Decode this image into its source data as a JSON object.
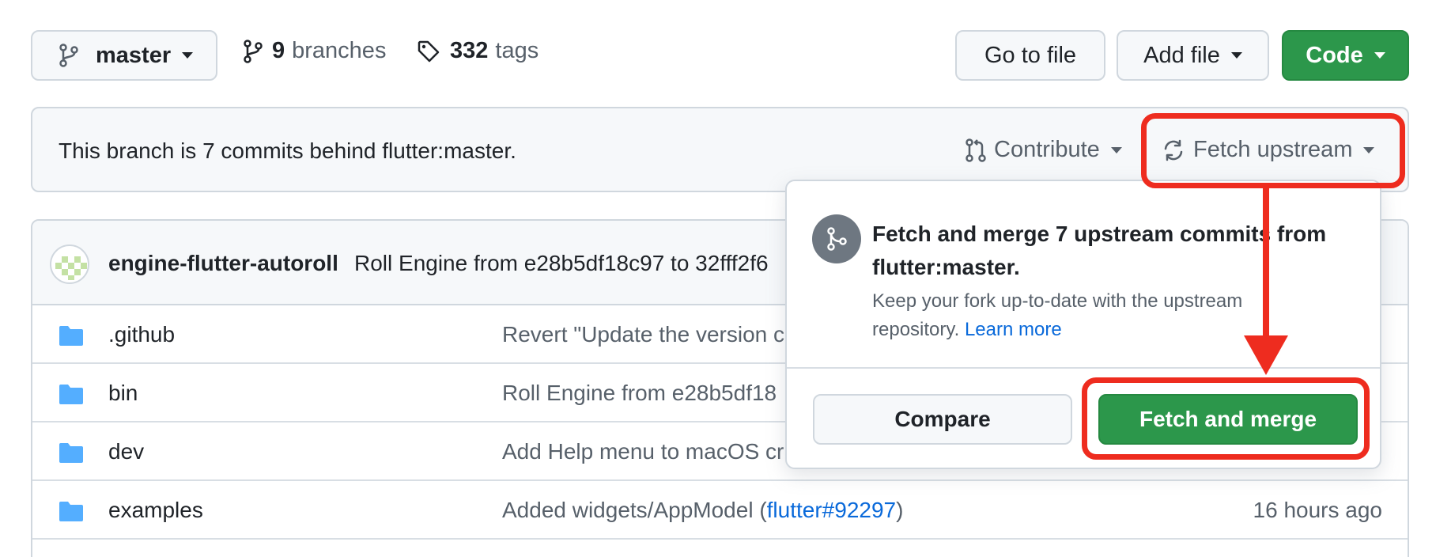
{
  "toolbar": {
    "branch_label": "master",
    "branches_count": "9",
    "branches_label": "branches",
    "tags_count": "332",
    "tags_label": "tags",
    "goto_file_label": "Go to file",
    "add_file_label": "Add file",
    "code_label": "Code",
    "code_color": "#2c974b"
  },
  "status_bar": {
    "behind_text": "This branch is 7 commits behind flutter:master.",
    "contribute_label": "Contribute",
    "fetch_upstream_label": "Fetch upstream"
  },
  "latest_commit": {
    "author": "engine-flutter-autoroll",
    "message": "Roll Engine from e28b5df18c97 to 32fff2f6"
  },
  "files": [
    {
      "name": ".github",
      "message": "Revert \"Update the version c",
      "link": "",
      "message_suffix": "",
      "age": ""
    },
    {
      "name": "bin",
      "message": "Roll Engine from e28b5df18",
      "link": "",
      "message_suffix": "",
      "age": ""
    },
    {
      "name": "dev",
      "message": "Add Help menu to macOS cr",
      "link": "",
      "message_suffix": "",
      "age": ""
    },
    {
      "name": "examples",
      "message": "Added widgets/AppModel (",
      "link": "flutter#92297",
      "message_suffix": ")",
      "age": "16 hours ago"
    }
  ],
  "popover": {
    "title": "Fetch and merge 7 upstream commits from flutter:master.",
    "description": "Keep your fork up-to-date with the upstream repository.",
    "learn_more": "Learn more",
    "compare_label": "Compare",
    "fetch_merge_label": "Fetch and merge"
  },
  "annotation_color": "#ee2c1f"
}
